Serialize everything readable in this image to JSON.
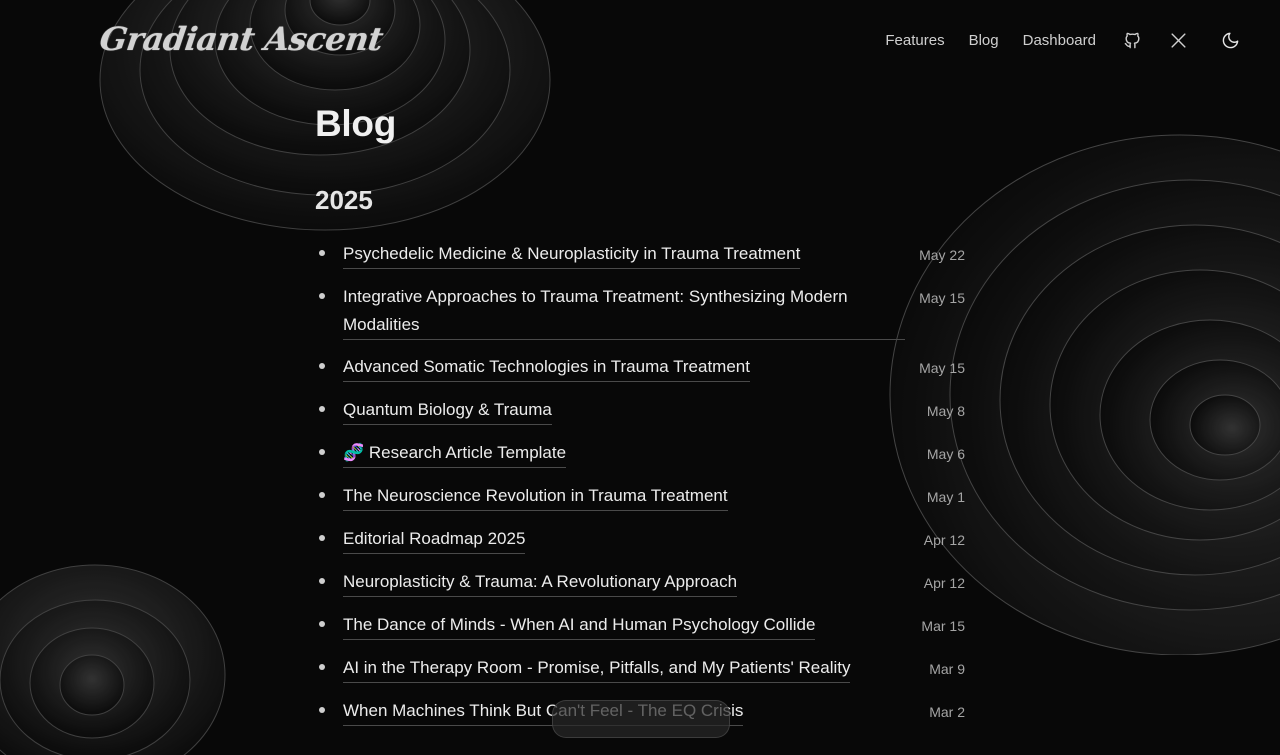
{
  "header": {
    "logo": "Gradiant Ascent",
    "nav": [
      {
        "label": "Features"
      },
      {
        "label": "Blog"
      },
      {
        "label": "Dashboard"
      }
    ],
    "icons": [
      "github-icon",
      "x-icon",
      "moon-icon"
    ]
  },
  "main": {
    "title": "Blog",
    "year": "2025",
    "posts": [
      {
        "title": "Psychedelic Medicine & Neuroplasticity in Trauma Treatment",
        "date": "May 22"
      },
      {
        "title": "Integrative Approaches to Trauma Treatment: Synthesizing Modern Modalities",
        "date": "May 15"
      },
      {
        "title": "Advanced Somatic Technologies in Trauma Treatment",
        "date": "May 15"
      },
      {
        "title": "Quantum Biology & Trauma",
        "date": "May 8"
      },
      {
        "title": "🧬 Research Article Template",
        "date": "May 6"
      },
      {
        "title": "The Neuroscience Revolution in Trauma Treatment",
        "date": "May 1"
      },
      {
        "title": "Editorial Roadmap 2025",
        "date": "Apr 12"
      },
      {
        "title": "Neuroplasticity & Trauma: A Revolutionary Approach",
        "date": "Apr 12"
      },
      {
        "title": "The Dance of Minds - When AI and Human Psychology Collide",
        "date": "Mar 15"
      },
      {
        "title": "AI in the Therapy Room - Promise, Pitfalls, and My Patients' Reality",
        "date": "Mar 9"
      },
      {
        "title": "When Machines Think But Can't Feel - The EQ Crisis",
        "date": "Mar 2"
      }
    ]
  },
  "colors": {
    "background": "#080808",
    "text": "#ececec",
    "muted": "#a5a5a5",
    "rule": "#4a4a4a"
  }
}
